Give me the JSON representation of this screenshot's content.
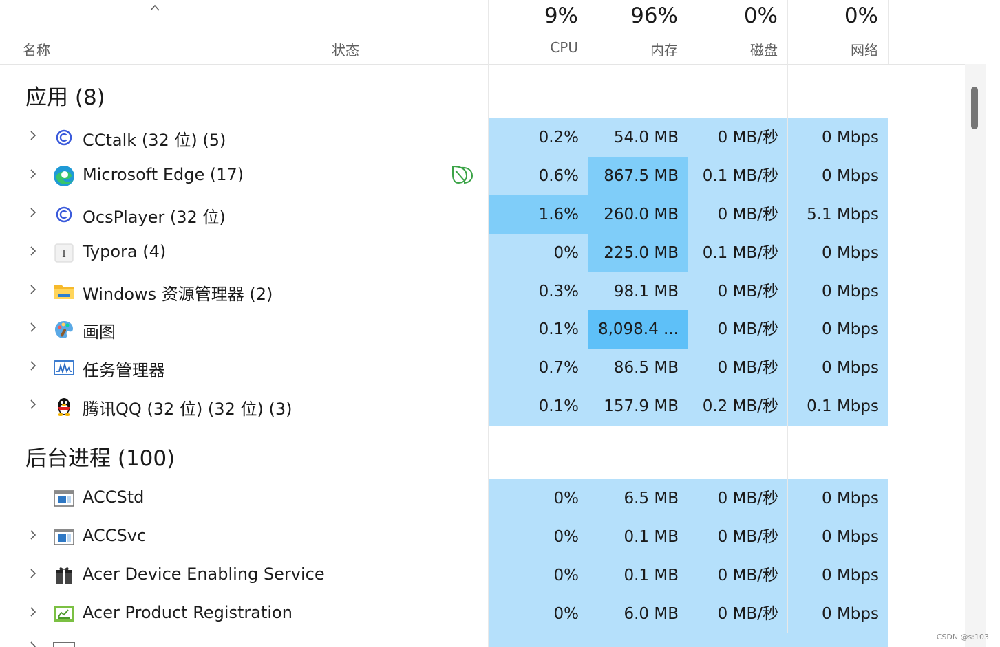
{
  "header": {
    "sort_icon": "chevron-up-icon",
    "name_label": "名称",
    "status_label": "状态",
    "cpu": {
      "pct": "9%",
      "label": "CPU"
    },
    "memory": {
      "pct": "96%",
      "label": "内存"
    },
    "disk": {
      "pct": "0%",
      "label": "磁盘"
    },
    "network": {
      "pct": "0%",
      "label": "网络"
    }
  },
  "groups": [
    {
      "title": "应用 (8)"
    },
    {
      "title": "后台进程 (100)"
    }
  ],
  "apps": [
    {
      "name": "CCtalk (32 位) (5)",
      "icon": "cctalk-icon",
      "cpu": "0.2%",
      "mem": "54.0 MB",
      "disk": "0 MB/秒",
      "net": "0 Mbps"
    },
    {
      "name": "Microsoft Edge (17)",
      "icon": "edge-icon",
      "status_icon": "efficiency-mode-leaf-icon",
      "cpu": "0.6%",
      "mem": "867.5 MB",
      "disk": "0.1 MB/秒",
      "net": "0 Mbps"
    },
    {
      "name": "OcsPlayer (32 位)",
      "icon": "ocsplayer-icon",
      "cpu": "1.6%",
      "mem": "260.0 MB",
      "disk": "0 MB/秒",
      "net": "5.1 Mbps"
    },
    {
      "name": "Typora (4)",
      "icon": "typora-icon",
      "cpu": "0%",
      "mem": "225.0 MB",
      "disk": "0.1 MB/秒",
      "net": "0 Mbps"
    },
    {
      "name": "Windows 资源管理器 (2)",
      "icon": "folder-icon",
      "cpu": "0.3%",
      "mem": "98.1 MB",
      "disk": "0 MB/秒",
      "net": "0 Mbps"
    },
    {
      "name": "画图",
      "icon": "paint-icon",
      "cpu": "0.1%",
      "mem": "8,098.4 ...",
      "disk": "0 MB/秒",
      "net": "0 Mbps"
    },
    {
      "name": "任务管理器",
      "icon": "task-manager-icon",
      "cpu": "0.7%",
      "mem": "86.5 MB",
      "disk": "0 MB/秒",
      "net": "0 Mbps"
    },
    {
      "name": "腾讯QQ (32 位) (32 位) (3)",
      "icon": "qq-penguin-icon",
      "cpu": "0.1%",
      "mem": "157.9 MB",
      "disk": "0.2 MB/秒",
      "net": "0.1 Mbps"
    }
  ],
  "background": [
    {
      "name": "ACCStd",
      "icon": "service-window-icon",
      "cpu": "0%",
      "mem": "6.5 MB",
      "disk": "0 MB/秒",
      "net": "0 Mbps"
    },
    {
      "name": "ACCSvc",
      "icon": "service-window-icon",
      "cpu": "0%",
      "mem": "0.1 MB",
      "disk": "0 MB/秒",
      "net": "0 Mbps"
    },
    {
      "name": "Acer Device Enabling Service",
      "icon": "gift-icon",
      "cpu": "0%",
      "mem": "0.1 MB",
      "disk": "0 MB/秒",
      "net": "0 Mbps"
    },
    {
      "name": "Acer Product Registration",
      "icon": "registration-icon",
      "cpu": "0%",
      "mem": "6.0 MB",
      "disk": "0 MB/秒",
      "net": "0 Mbps"
    }
  ],
  "colors": {
    "heat_low": "#cde9fb",
    "heat_mid": "#b5e0fb",
    "heat_high": "#7fcdf9",
    "heat_max": "#5ec0f8"
  },
  "watermark": "CSDN @s:103"
}
